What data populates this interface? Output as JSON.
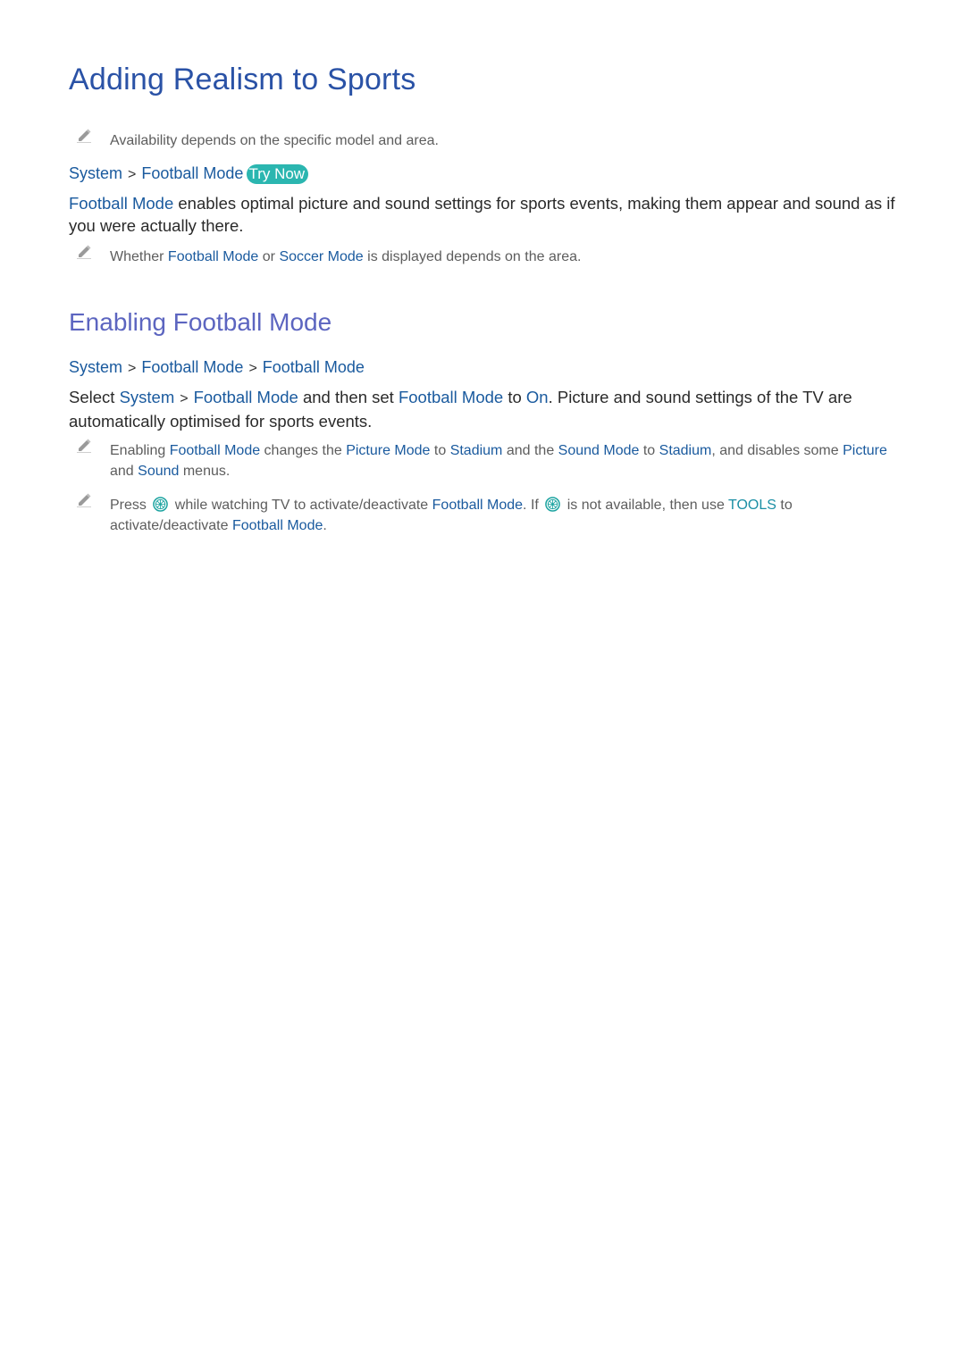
{
  "heading1": "Adding Realism to Sports",
  "note1": "Availability depends on the specific model and area.",
  "path1": {
    "items": [
      "System",
      "Football Mode"
    ],
    "try_now": "Try Now"
  },
  "para1": {
    "kw": "Football Mode",
    "text": " enables optimal picture and sound settings for sports events, making them appear and sound as if you were actually there."
  },
  "note2": {
    "t1": "Whether ",
    "k1": "Football Mode",
    "t2": " or ",
    "k2": "Soccer Mode",
    "t3": " is displayed depends on the area."
  },
  "heading2": "Enabling Football Mode",
  "path2": {
    "items": [
      "System",
      "Football Mode",
      "Football Mode"
    ]
  },
  "para2": {
    "t1": "Select ",
    "k1": "System",
    "k2": "Football Mode",
    "t2": " and then set ",
    "k3": "Football Mode",
    "t3": " to ",
    "k4": "On",
    "t4": ". Picture and sound settings of the TV are automatically optimised for sports events."
  },
  "note3": {
    "t1": "Enabling ",
    "k1": "Football Mode",
    "t2": " changes the ",
    "k2": "Picture Mode",
    "t3": " to ",
    "k3": "Stadium",
    "t4": " and the ",
    "k4": "Sound Mode",
    "t5": " to ",
    "k5": "Stadium",
    "t6": ", and disables some ",
    "k6": "Picture",
    "t7": " and ",
    "k7": "Sound",
    "t8": " menus."
  },
  "note4": {
    "t1": "Press ",
    "t2": " while watching TV to activate/deactivate ",
    "k1": "Football Mode",
    "t3": ". If ",
    "t4": " is not available, then use ",
    "k2": "TOOLS",
    "t5": " to activate/deactivate ",
    "k3": "Football Mode",
    "t6": "."
  },
  "colors": {
    "heading1": "#2a52a6",
    "heading2": "#5c65c0",
    "keyword": "#1a5a9e",
    "try_now_bg": "#2bb6b0"
  }
}
